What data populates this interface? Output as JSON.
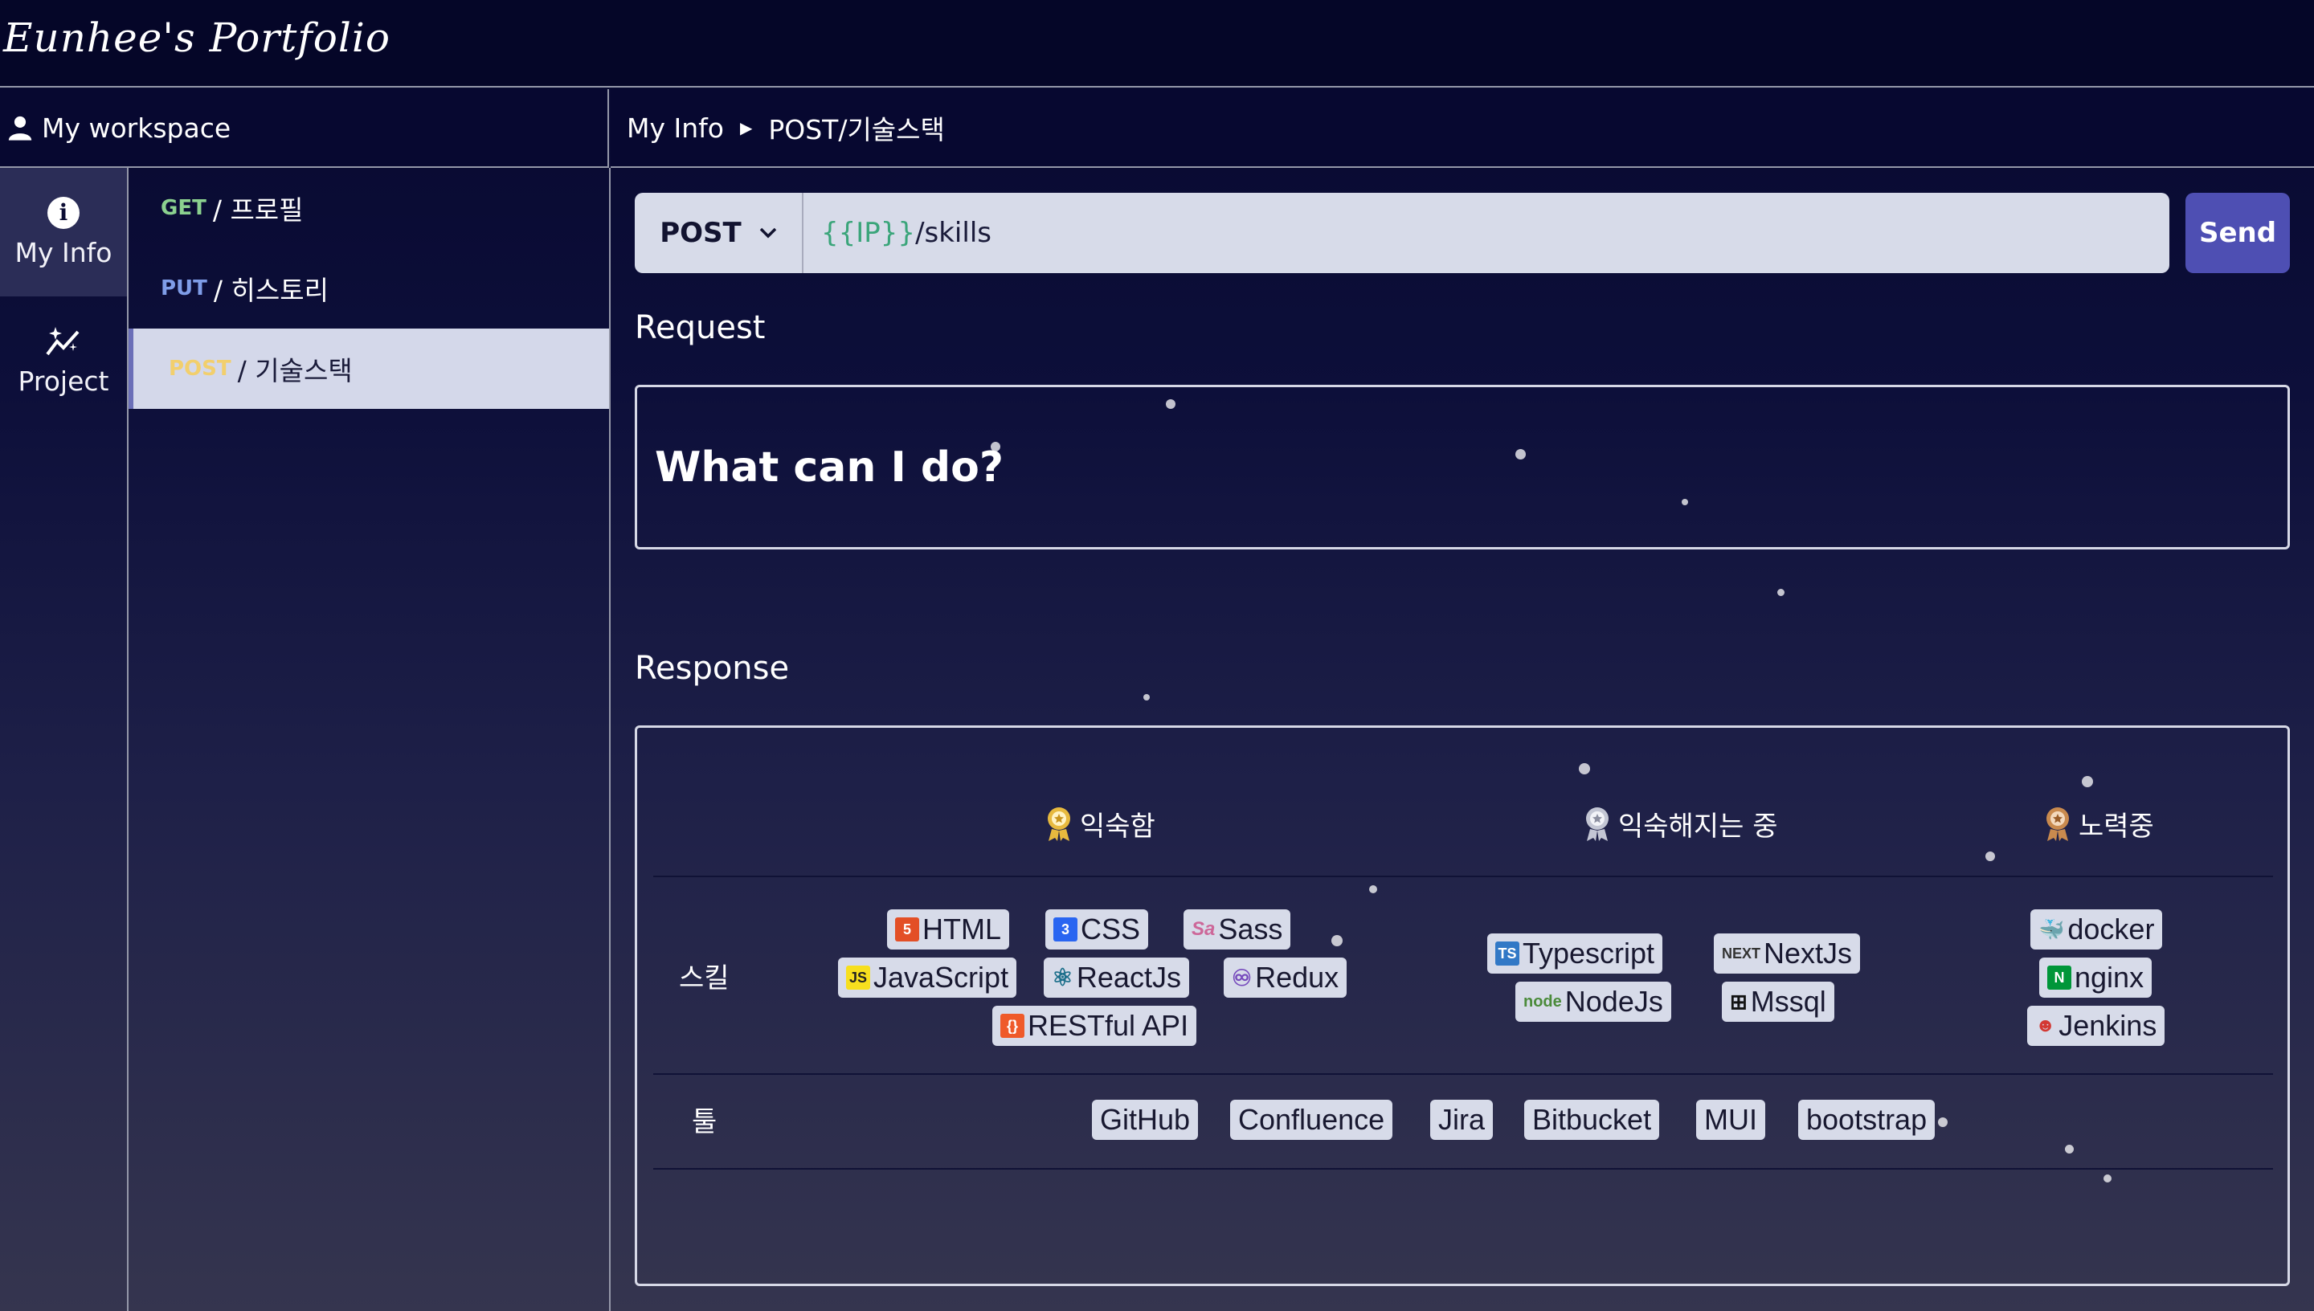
{
  "header": {
    "logo": "Eunhee's Portfolio"
  },
  "workspace": {
    "label": "My workspace"
  },
  "breadcrumb": {
    "items": [
      "My Info",
      "POST/기술스택"
    ]
  },
  "rail": {
    "items": [
      {
        "label": "My Info",
        "icon": "info-icon",
        "active": true
      },
      {
        "label": "Project",
        "icon": "sparkle-chart-icon",
        "active": false
      }
    ]
  },
  "endpoints": [
    {
      "method": "GET",
      "path": "/ 프로필",
      "active": false
    },
    {
      "method": "PUT",
      "path": "/ 히스토리",
      "active": false
    },
    {
      "method": "POST",
      "path": "/ 기술스택",
      "active": true
    }
  ],
  "request_bar": {
    "method": "POST",
    "url_var": "{{IP}}",
    "url_path": "/skills",
    "send_label": "Send"
  },
  "request": {
    "title": "Request",
    "body": "What can I do?"
  },
  "response": {
    "title": "Response",
    "columns": [
      "익숙함",
      "익숙해지는 중",
      "노력중"
    ],
    "rows": {
      "skill": {
        "label": "스킬",
        "familiar": [
          "HTML",
          "CSS",
          "Sass",
          "JavaScript",
          "ReactJs",
          "Redux",
          "RESTful API"
        ],
        "learning": [
          "Typescript",
          "NextJs",
          "NodeJs",
          "Mssql"
        ],
        "trying": [
          "docker",
          "nginx",
          "Jenkins"
        ]
      },
      "tool": {
        "label": "툴",
        "items": [
          "GitHub",
          "Confluence",
          "Jira",
          "Bitbucket",
          "MUI",
          "bootstrap"
        ]
      }
    }
  },
  "colors": {
    "background_top": "#07082e",
    "background_bottom": "#35354f",
    "panel_light": "#d7dbe9",
    "send_button": "#4e4fb3",
    "get": "#8bd18f",
    "put": "#7f9de8",
    "post": "#f2cf6d",
    "url_variable": "#3aa57a"
  }
}
